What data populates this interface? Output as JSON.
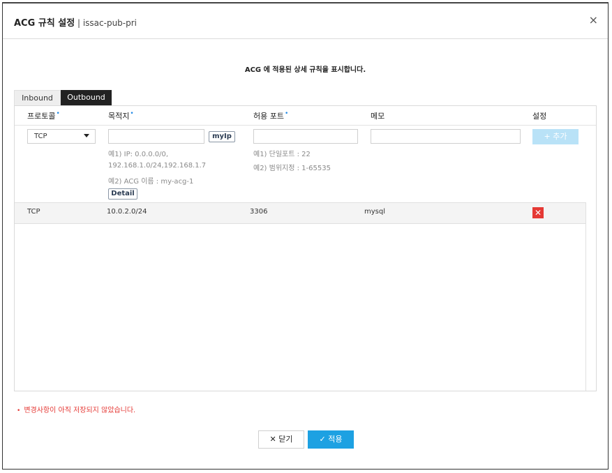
{
  "dialog": {
    "title": "ACG 규칙 설정",
    "subtitle": " | issac-pub-pri",
    "close_symbol": "×",
    "description": "ACG 에 적용된 상세 규칙을 표시합니다."
  },
  "tabs": [
    {
      "label": "Inbound",
      "active": false
    },
    {
      "label": "Outbound",
      "active": true
    }
  ],
  "columns": {
    "protocol": "프로토콜",
    "destination": "목적지",
    "port": "허용 포트",
    "memo": "메모",
    "settings": "설정"
  },
  "required_marker": "•",
  "form": {
    "protocol_value": "TCP",
    "destination_value": "",
    "myip_label": "myIp",
    "destination_hint_1a": "예1) IP: 0.0.0.0/0,",
    "destination_hint_1b": "192.168.1.0/24,192.168.1.7",
    "destination_hint_2": "예2) ACG 이름 : my-acg-1",
    "detail_label": "Detail",
    "port_value": "",
    "port_hint_1": "예1) 단일포트 : 22",
    "port_hint_2": "예2) 범위지정 : 1-65535",
    "memo_value": "",
    "add_label": "+ 추가"
  },
  "rules": [
    {
      "protocol": "TCP",
      "destination": "10.0.2.0/24",
      "port": "3306",
      "memo": "mysql",
      "delete_symbol": "✕"
    }
  ],
  "warning": "변경사항이 아직 저장되지 않았습니다.",
  "warning_bullet": "•",
  "footer": {
    "close_label": "✕ 닫기",
    "apply_label": "✓ 적용"
  },
  "colors": {
    "accent": "#1da1e2",
    "add_disabled": "#b9e2f7",
    "danger": "#e53935",
    "tab_active": "#222222"
  },
  "icons": {
    "close": "close-icon",
    "caret": "caret-down-icon",
    "delete": "delete-x-icon",
    "plus": "plus-icon",
    "check": "check-icon"
  }
}
